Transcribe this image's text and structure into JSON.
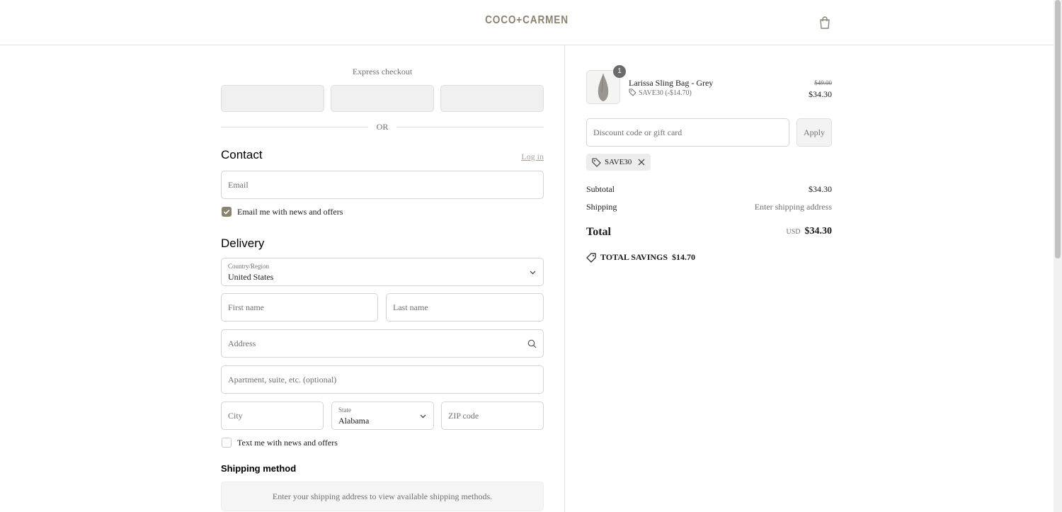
{
  "header": {
    "brand": "COCO+CARMEN",
    "cart_icon": "bag-icon"
  },
  "express": {
    "label": "Express checkout",
    "divider": "OR"
  },
  "contact": {
    "heading": "Contact",
    "login_link": "Log in",
    "email_placeholder": "Email",
    "newsletter_label": "Email me with news and offers",
    "newsletter_checked": true
  },
  "delivery": {
    "heading": "Delivery",
    "country_label": "Country/Region",
    "country_value": "United States",
    "first_name_placeholder": "First name",
    "last_name_placeholder": "Last name",
    "address_placeholder": "Address",
    "apartment_placeholder": "Apartment, suite, etc. (optional)",
    "city_placeholder": "City",
    "state_label": "State",
    "state_value": "Alabama",
    "zip_placeholder": "ZIP code",
    "sms_label": "Text me with news and offers",
    "sms_checked": false
  },
  "shipping": {
    "heading": "Shipping method",
    "message": "Enter your shipping address to view available shipping methods."
  },
  "order": {
    "item": {
      "name": "Larissa Sling Bag - Grey",
      "quantity": "1",
      "discount": "SAVE30 (-$14.70)",
      "original_price": "$49.00",
      "price": "$34.30"
    },
    "discount_placeholder": "Discount code or gift card",
    "apply_label": "Apply",
    "applied_code": "SAVE30",
    "subtotal_label": "Subtotal",
    "subtotal_value": "$34.30",
    "shipping_label": "Shipping",
    "shipping_value": "Enter shipping address",
    "total_label": "Total",
    "currency": "USD",
    "total_value": "$34.30",
    "savings_label": "TOTAL SAVINGS",
    "savings_value": "$14.70"
  },
  "colors": {
    "accent": "#8b8270",
    "border": "#d4d4d4",
    "muted": "#707070"
  }
}
